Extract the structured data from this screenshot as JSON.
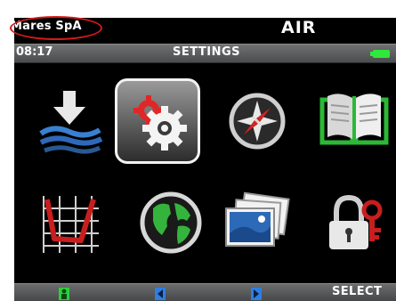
{
  "header": {
    "carrier": "Mares SpA",
    "app_title": "AIR"
  },
  "status": {
    "time": "08:17",
    "section": "SETTINGS",
    "battery": "battery-full-icon",
    "battery_color": "#2fe83b"
  },
  "menu": {
    "items": [
      {
        "icon": "dive-descent-icon"
      },
      {
        "icon": "settings-gears-icon",
        "selected": true
      },
      {
        "icon": "compass-icon"
      },
      {
        "icon": "logbook-icon"
      },
      {
        "icon": "dive-profile-icon"
      },
      {
        "icon": "globe-icon"
      },
      {
        "icon": "photo-gallery-icon"
      },
      {
        "icon": "lock-key-icon"
      }
    ]
  },
  "softkeys": {
    "left_icon": "diver-icon",
    "prev_icon": "arrow-left-icon",
    "next_icon": "arrow-right-icon",
    "select_label": "SELECT"
  },
  "annotation": {
    "color": "#d21a1a"
  }
}
